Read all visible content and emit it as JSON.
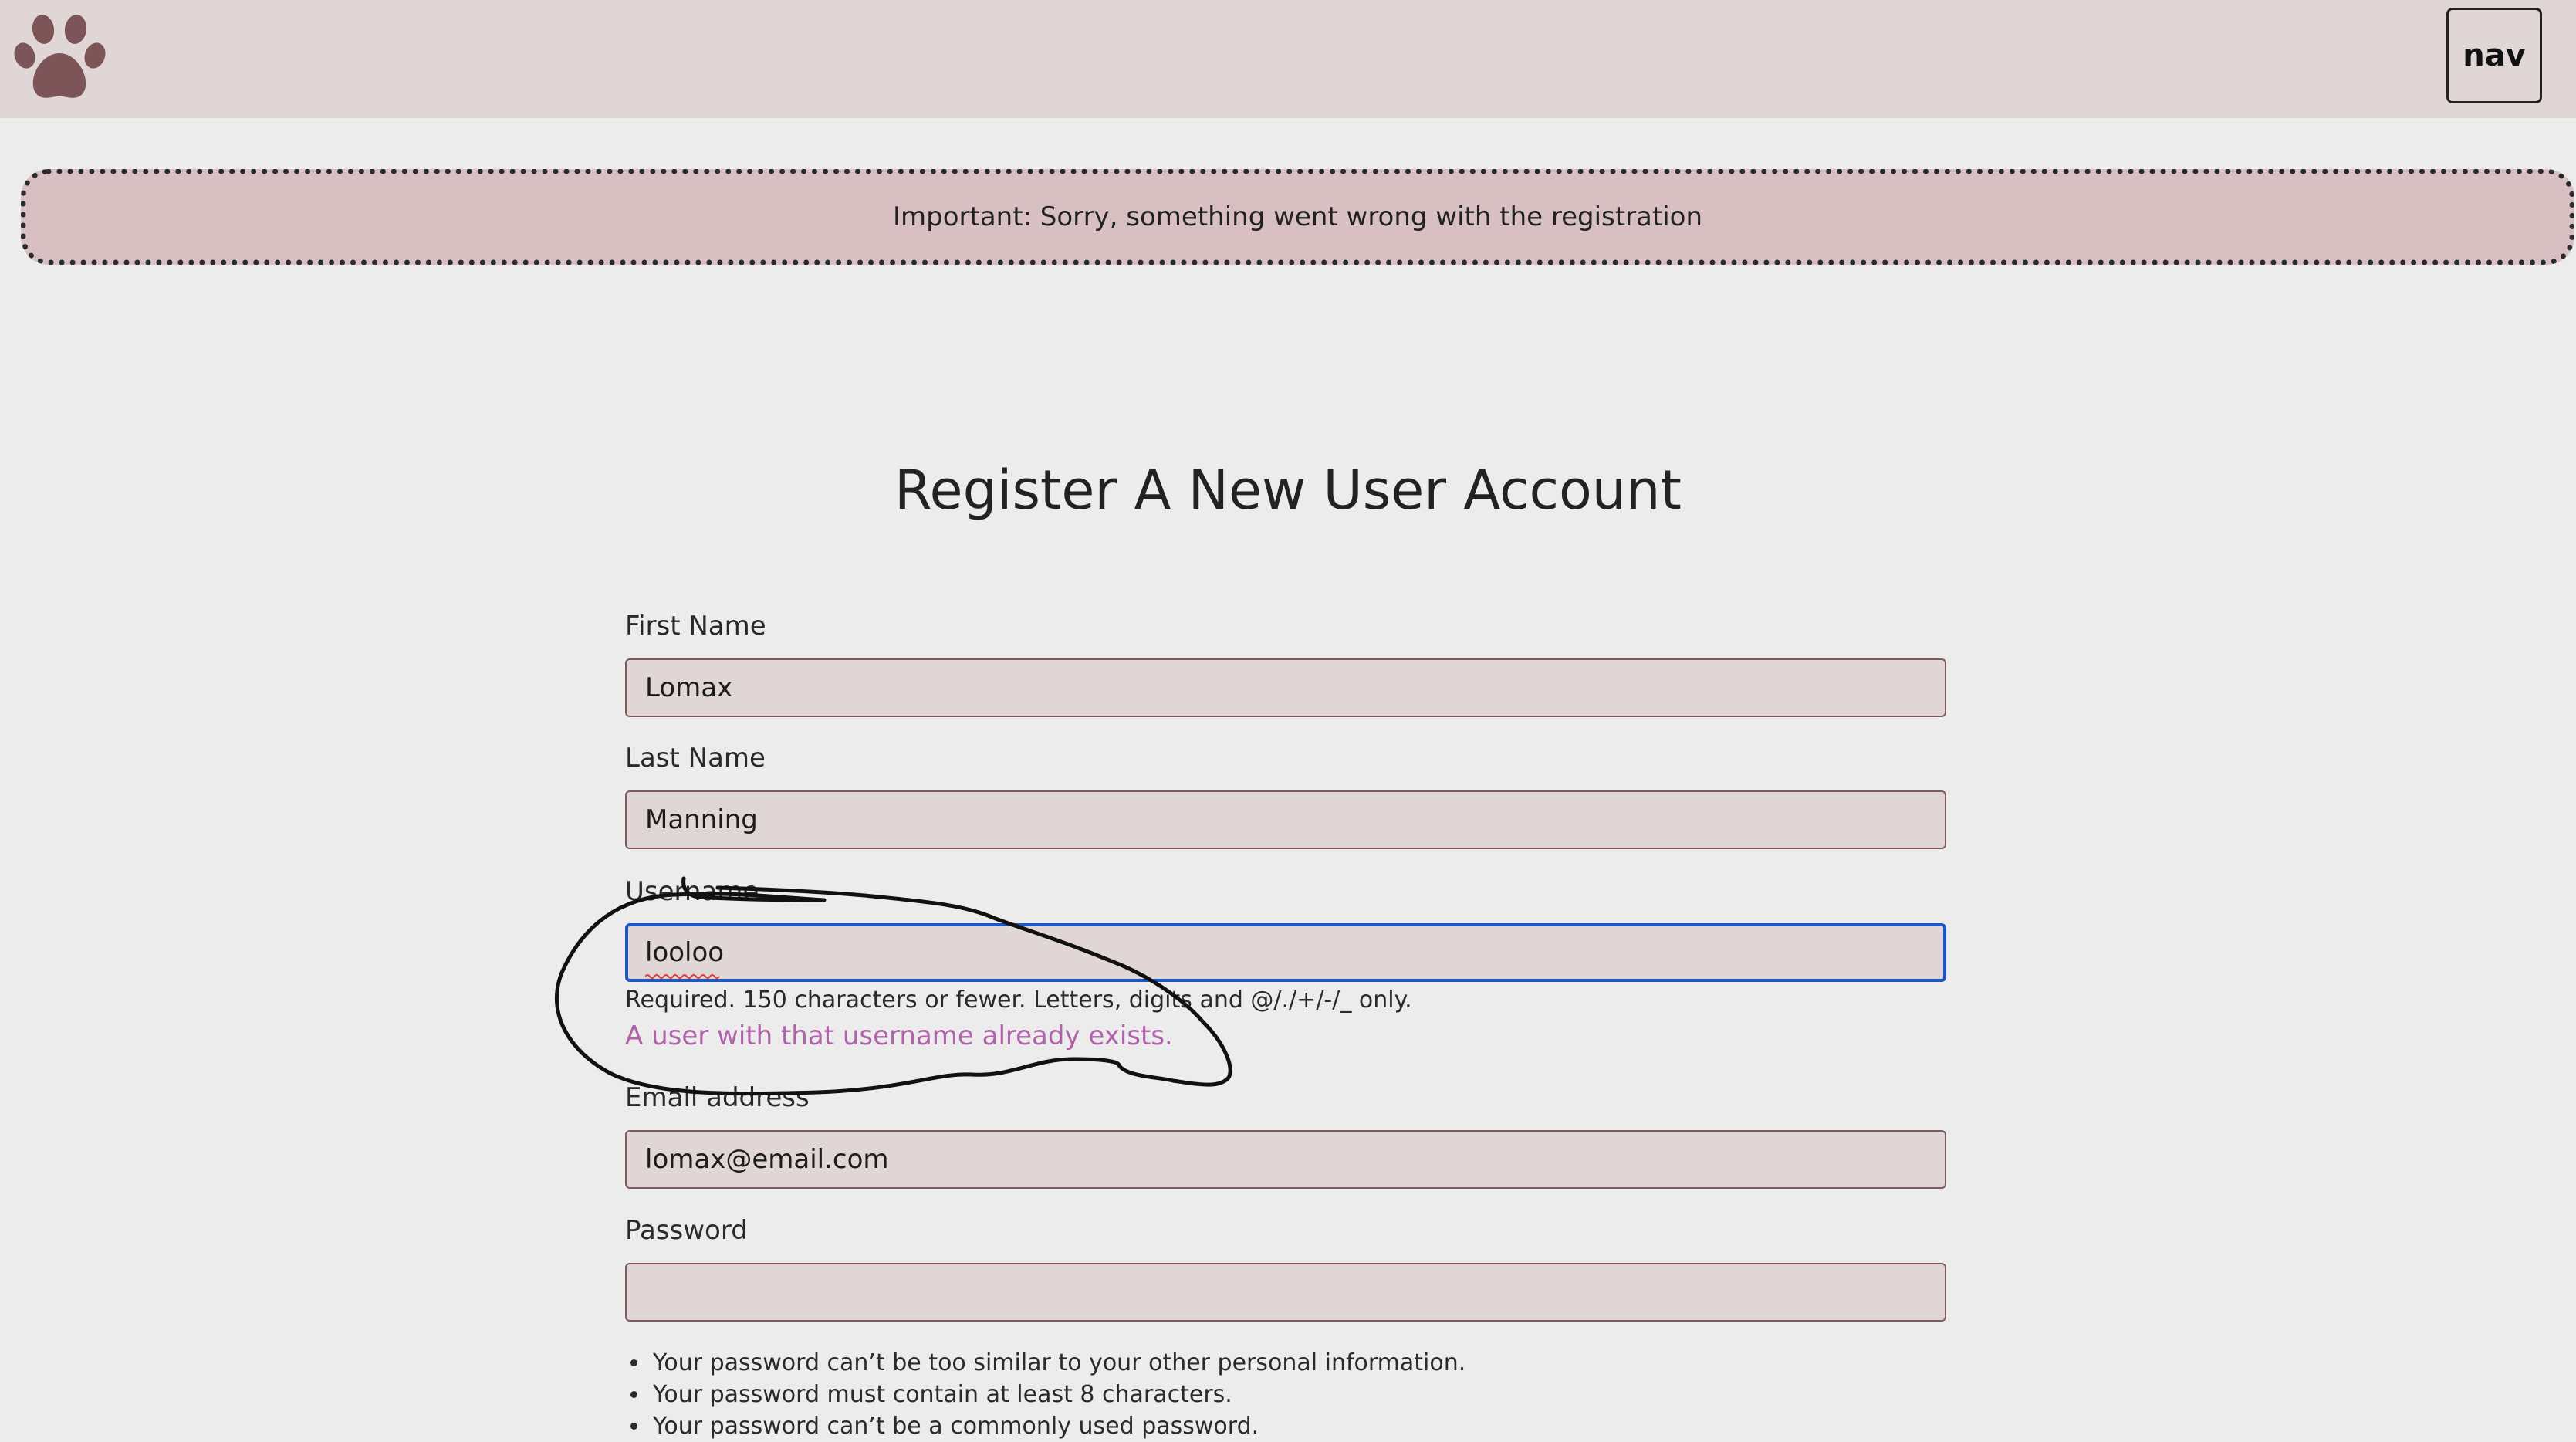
{
  "header": {
    "logo_icon": "paw-icon",
    "nav_label": "nav"
  },
  "alert": {
    "message": "Important: Sorry, something went wrong with the registration"
  },
  "page": {
    "title": "Register A New User Account"
  },
  "form": {
    "first_name": {
      "label": "First Name",
      "value": "Lomax"
    },
    "last_name": {
      "label": "Last Name",
      "value": "Manning"
    },
    "username": {
      "label": "Username",
      "value": "looloo",
      "help": "Required. 150 characters or fewer. Letters, digits and @/./+/-/_ only.",
      "error": "A user with that username already exists."
    },
    "email": {
      "label": "Email address",
      "value": "lomax@email.com"
    },
    "password": {
      "label": "Password",
      "value": "",
      "rules": [
        "Your password can’t be too similar to your other personal information.",
        "Your password must contain at least 8 characters.",
        "Your password can’t be a commonly used password."
      ]
    }
  },
  "colors": {
    "header_bg": "#e0d6d6",
    "page_bg": "#ececec",
    "alert_bg": "#d8bfc1",
    "field_bg": "#e0d6d6",
    "field_border": "#7e5a5e",
    "focus_border": "#1e56c4",
    "error_text": "#b063a8",
    "logo": "#7d5558"
  }
}
